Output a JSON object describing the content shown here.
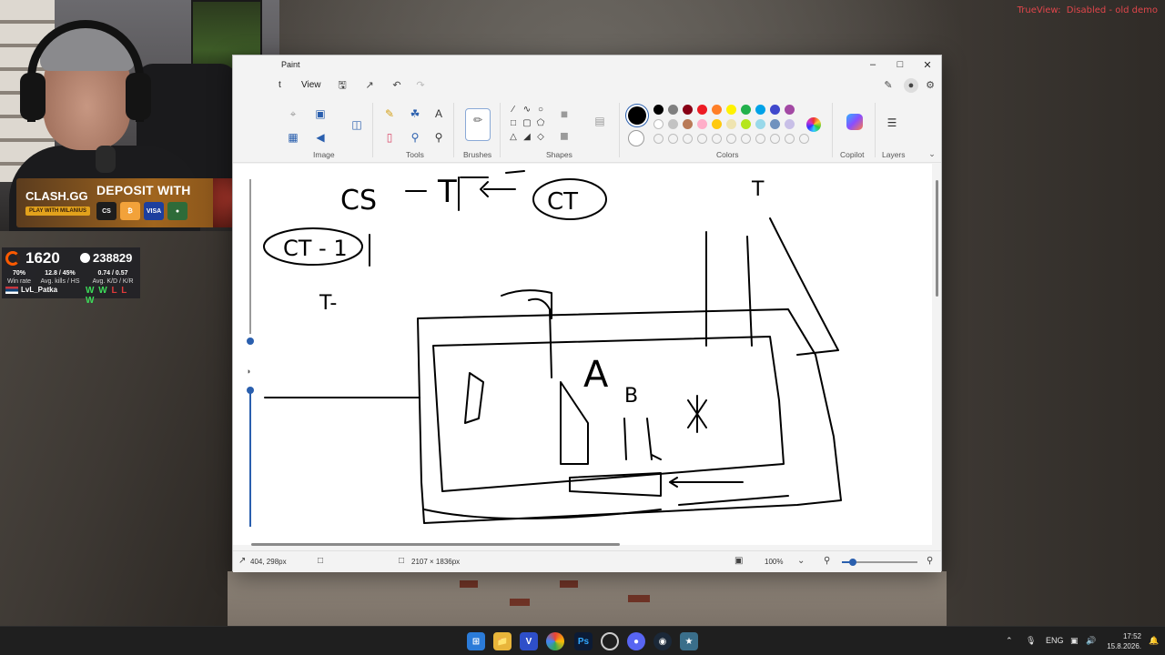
{
  "overlay": {
    "trueview_label": "TrueView:",
    "trueview_status": "Disabled - old demo"
  },
  "promo": {
    "brand": "CLASH.GG",
    "sub": "PLAY WITH MILANIUS",
    "cta": "DEPOSIT WITH",
    "badges": [
      "CS",
      "₿",
      "VISA",
      "●"
    ]
  },
  "stats": {
    "elo": "1620",
    "points": "238829",
    "win_rate": "70%",
    "win_rate_label": "Win rate",
    "kills_hs": "12.8 / 45%",
    "kills_hs_label": "Avg. kills / HS",
    "kd_kr": "0.74 / 0.57",
    "kd_kr_label": "Avg. K/D / K/R",
    "username": "LvL_Patka",
    "recent_results": [
      "W",
      "W",
      "L",
      "L",
      "W"
    ]
  },
  "paint": {
    "title": "Paint",
    "menu": {
      "file_partial": "t",
      "view": "View"
    },
    "groups": {
      "image": "Image",
      "tools": "Tools",
      "brushes": "Brushes",
      "shapes": "Shapes",
      "colors": "Colors",
      "copilot": "Copilot",
      "layers": "Layers"
    },
    "palette_row1": [
      "#000000",
      "#7f7f7f",
      "#880015",
      "#ed1c24",
      "#ff7f27",
      "#fff200",
      "#22b14c",
      "#00a2e8",
      "#3f48cc",
      "#a349a4"
    ],
    "palette_row2": [
      "#ffffff",
      "#c3c3c3",
      "#b97a57",
      "#ffaec9",
      "#ffc90e",
      "#efe4b0",
      "#b5e61d",
      "#99d9ea",
      "#7092be",
      "#c8bfe7"
    ],
    "status": {
      "cursor": "404, 298px",
      "canvas_size": "2107 × 1836px",
      "zoom": "100%",
      "zoom_level": 0.12
    },
    "sketch": {
      "line1_left": "CS",
      "line1_mid": "T",
      "line1_right": "CT",
      "score_line": "CT - 1",
      "t_line": "T-",
      "site_a": "A",
      "site_b": "B",
      "right_t": "T"
    }
  },
  "taskbar": {
    "apps": [
      "start",
      "explorer",
      "V",
      "chrome",
      "Ps",
      "obs",
      "discord",
      "steam",
      "cs2"
    ],
    "lang": "ENG",
    "time": "17:52",
    "date": "15.8.2026."
  }
}
